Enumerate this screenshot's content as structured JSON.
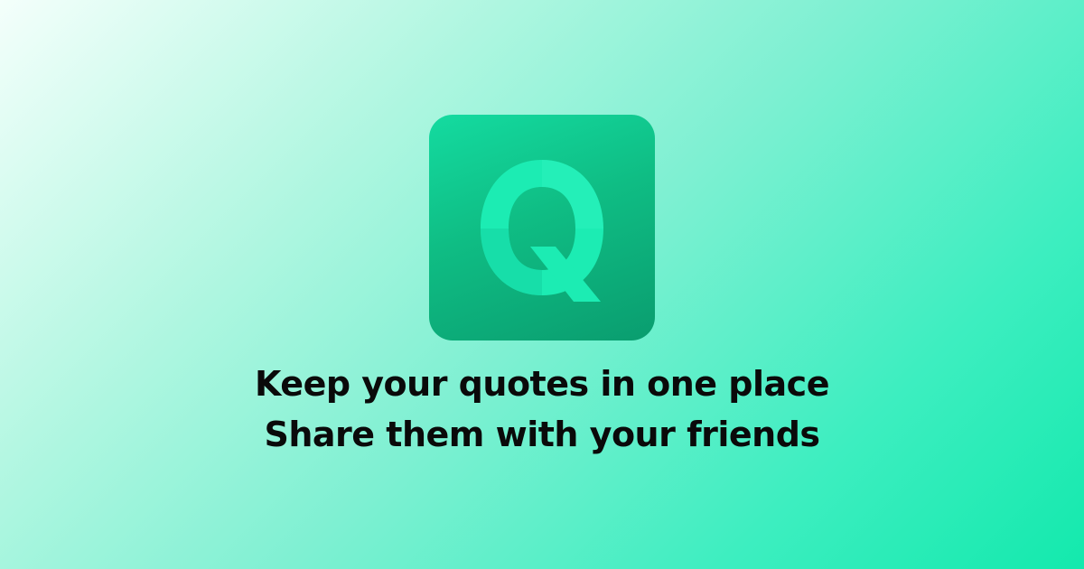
{
  "logo": {
    "icon": "q-letter-icon",
    "letter": "Q",
    "colors": {
      "tile_top": "#14dba0",
      "tile_bottom": "#0a9d6f",
      "letter": "#1ef0b6",
      "letter_shade": "#17d6a0"
    }
  },
  "tagline": {
    "line1": "Keep your quotes in one place",
    "line2": "Share them with your friends"
  },
  "background": {
    "from": "#f4fffb",
    "to": "#13e9ad"
  }
}
